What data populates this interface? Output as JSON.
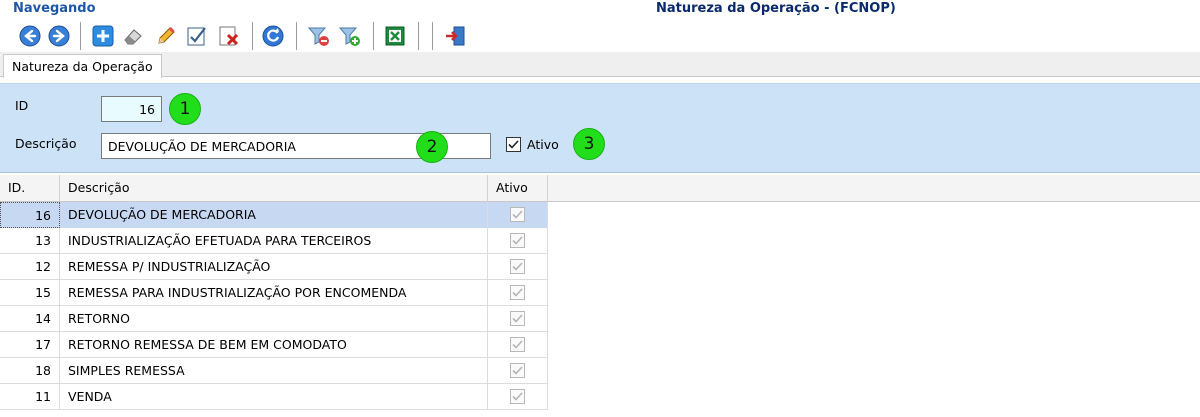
{
  "titlebar": {
    "mode": "Navegando",
    "title": "Natureza da Operação - (FCNOP)"
  },
  "toolbar": {
    "buttons": [
      {
        "icon": "back-arrow-icon"
      },
      {
        "icon": "forward-arrow-icon"
      },
      {
        "icon": "add-icon"
      },
      {
        "icon": "eraser-icon"
      },
      {
        "icon": "pencil-icon"
      },
      {
        "icon": "edit-check-icon"
      },
      {
        "icon": "delete-icon"
      },
      {
        "icon": "refresh-icon"
      },
      {
        "icon": "filter-remove-icon"
      },
      {
        "icon": "filter-add-icon"
      },
      {
        "icon": "excel-icon"
      },
      {
        "icon": "exit-icon"
      }
    ]
  },
  "tab": {
    "label": "Natureza da Operação"
  },
  "form": {
    "id_label": "ID",
    "id_value": "16",
    "desc_label": "Descrição",
    "desc_value": "DEVOLUÇÃO DE MERCADORIA",
    "ativo_label": "Ativo",
    "ativo_checked": true,
    "badges": [
      "1",
      "2",
      "3"
    ]
  },
  "grid": {
    "headers": {
      "id": "ID.",
      "desc": "Descrição",
      "ativo": "Ativo"
    },
    "rows": [
      {
        "id": "16",
        "desc": "DEVOLUÇÃO DE MERCADORIA",
        "ativo": true,
        "selected": true
      },
      {
        "id": "13",
        "desc": "INDUSTRIALIZAÇÃO EFETUADA PARA TERCEIROS",
        "ativo": true
      },
      {
        "id": "12",
        "desc": "REMESSA P/ INDUSTRIALIZAÇÃO",
        "ativo": true
      },
      {
        "id": "15",
        "desc": "REMESSA PARA INDUSTRIALIZAÇÃO POR ENCOMENDA",
        "ativo": true
      },
      {
        "id": "14",
        "desc": "RETORNO",
        "ativo": true
      },
      {
        "id": "17",
        "desc": "RETORNO REMESSA DE BEM EM COMODATO",
        "ativo": true
      },
      {
        "id": "18",
        "desc": "SIMPLES REMESSA",
        "ativo": true
      },
      {
        "id": "11",
        "desc": "VENDA",
        "ativo": true
      }
    ]
  }
}
